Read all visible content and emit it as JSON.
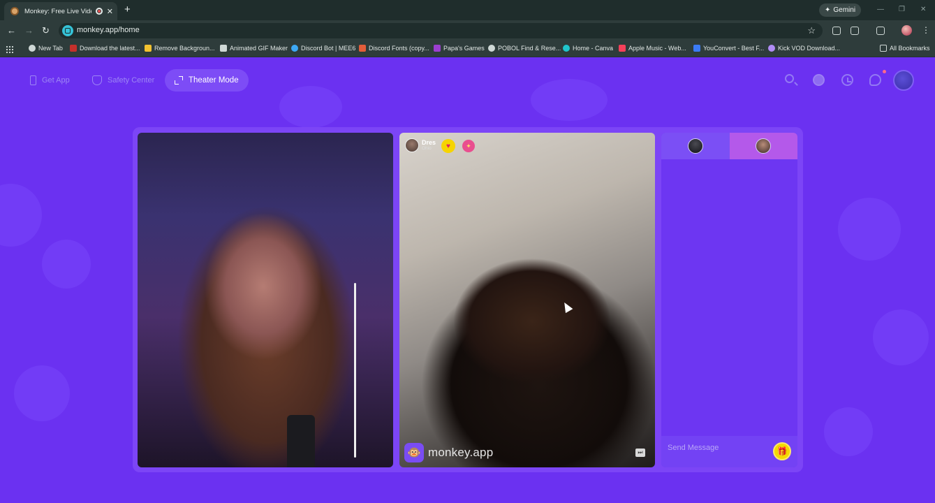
{
  "browser": {
    "tab_title": "Monkey: Free Live Video Chat",
    "new_tab_symbol": "+",
    "tab_close_symbol": "✕",
    "gemini_label": "Gemini",
    "url": "monkey.app/home",
    "bookmarks": [
      {
        "label": "New Tab",
        "color": "#cfd8d6"
      },
      {
        "label": "Download the latest...",
        "color": "#c4302b"
      },
      {
        "label": "Remove Backgroun...",
        "color": "#f2c230"
      },
      {
        "label": "Animated GIF Maker",
        "color": "#cfd8d6"
      },
      {
        "label": "Discord Bot | MEE6",
        "color": "#3da9f5"
      },
      {
        "label": "Discord Fonts (copy...",
        "color": "#e35d3a"
      },
      {
        "label": "Papa's Games",
        "color": "#9b3fd0"
      },
      {
        "label": "POBOL Find & Rese...",
        "color": "#cfd8d6"
      },
      {
        "label": "Home - Canva",
        "color": "#20c4cb"
      },
      {
        "label": "Apple Music - Web...",
        "color": "#f5405a"
      },
      {
        "label": "YouConvert - Best F...",
        "color": "#3b7bf5"
      },
      {
        "label": "Kick VOD Download...",
        "color": "#b08cf5"
      }
    ],
    "all_bookmarks_label": "All Bookmarks"
  },
  "header": {
    "get_app_label": "Get App",
    "safety_center_label": "Safety Center",
    "theater_mode_label": "Theater Mode"
  },
  "peer": {
    "name": "Dres",
    "location": "Ohio",
    "heart_badge": "♥",
    "gift_badge": "✦"
  },
  "branding": {
    "logo_glyph": "🐵",
    "watermark": "monkey.app",
    "skip_glyph": "⏭"
  },
  "chat": {
    "placeholder": "Send Message",
    "gift_glyph": "🎁"
  },
  "colors": {
    "page_bg": "#6b31f1",
    "stage_bg": "#7c45f6",
    "accent_yellow": "#f4d900",
    "tab_active_pink": "#b459ea"
  }
}
